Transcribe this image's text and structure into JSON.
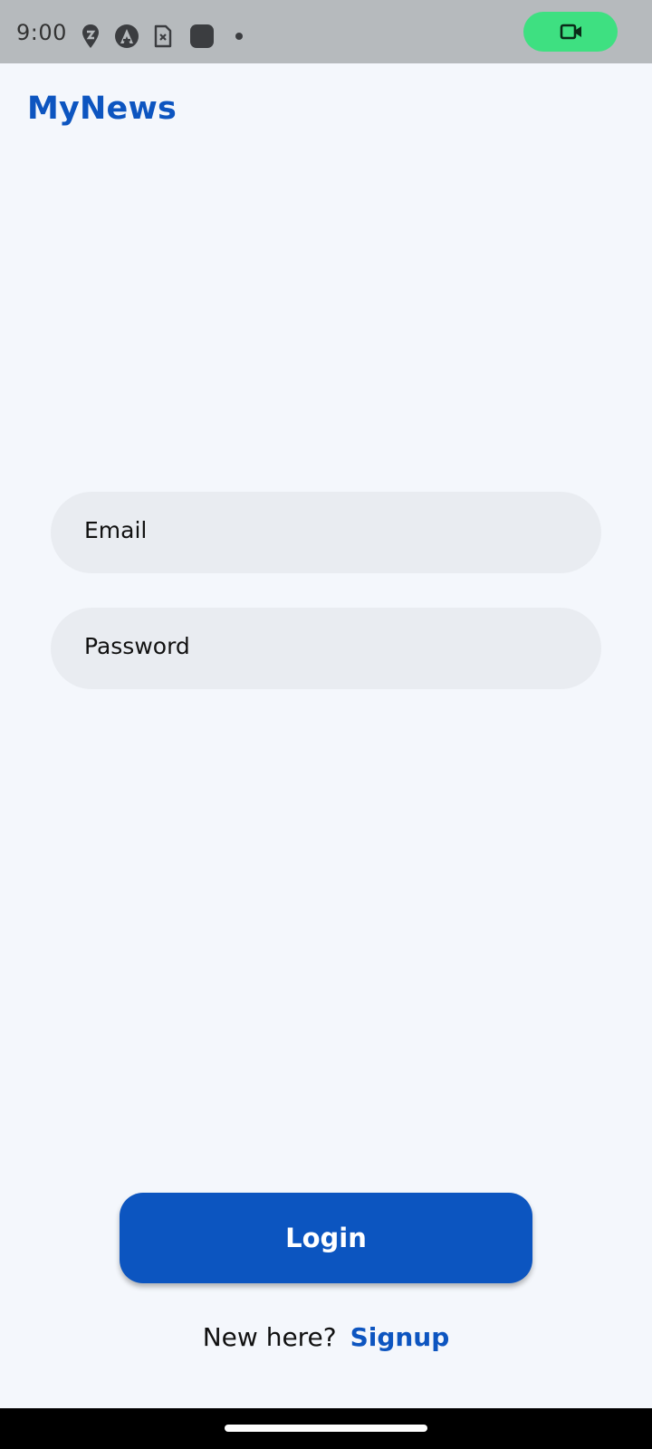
{
  "status_bar": {
    "time": "9:00",
    "icons": [
      "location-pin-icon",
      "assistant-icon",
      "sim-card-icon",
      "app-square-icon",
      "notification-dot-icon"
    ],
    "record_icon": "video-camera-icon",
    "record_color": "#3ee081"
  },
  "app": {
    "title": "MyNews",
    "brand_color": "#0d55c0"
  },
  "form": {
    "email_placeholder": "Email",
    "email_value": "",
    "password_placeholder": "Password",
    "password_value": ""
  },
  "actions": {
    "login_label": "Login",
    "signup_prompt": "New here?",
    "signup_link": "Signup"
  }
}
